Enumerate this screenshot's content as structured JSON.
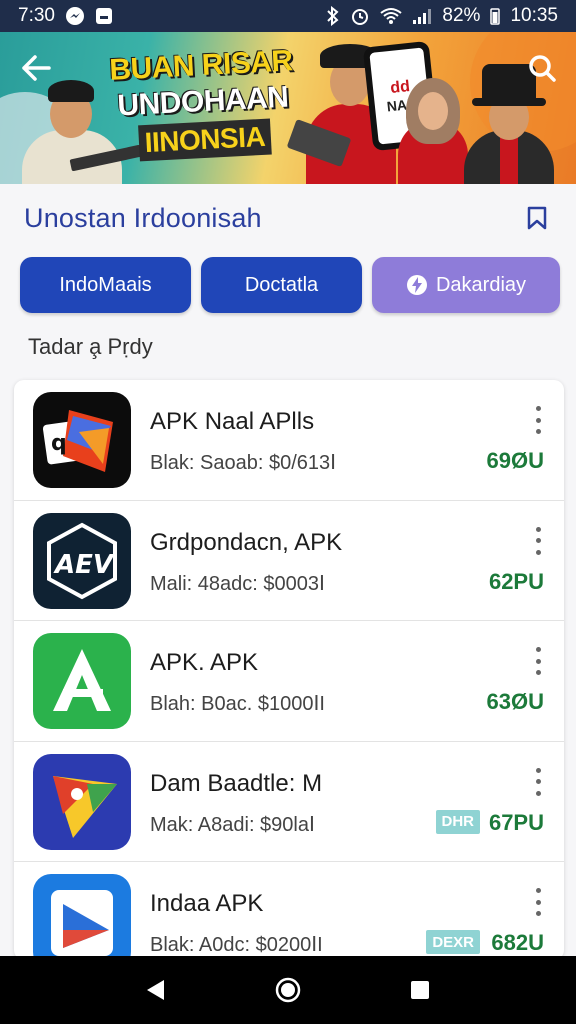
{
  "status_bar": {
    "time": "7:30",
    "battery": "82%",
    "clock": "10:35",
    "icons": [
      "messenger-icon",
      "app-icon",
      "bluetooth-icon",
      "alarm-icon",
      "wifi-icon",
      "signal-icon",
      "battery-icon"
    ]
  },
  "banner": {
    "title_line1": "BUAN RISAR",
    "title_line2": "UNDOHAAN",
    "title_line3": "IINONSIA",
    "phone_text_top": "dd",
    "phone_text_bottom": "NAR"
  },
  "section": {
    "title": "Unostan  Irdoonisah"
  },
  "chips": [
    {
      "label": "IndoMaais"
    },
    {
      "label": "Doctatla"
    },
    {
      "label": "Dakardiay"
    }
  ],
  "sub_label": "Tadar a̧ Pṛdy",
  "apps": [
    {
      "name": "APK Naal APlls",
      "meta": "Blak: Saoab: $0/613Ⅰ",
      "price": "69ØU",
      "tag": ""
    },
    {
      "name": "Grdpondacn, APK",
      "meta": "Mali: 48adc: $0003Ⅰ",
      "price": "62PU",
      "tag": ""
    },
    {
      "name": "APK. APK",
      "meta": "Blah: B0ac. $1000ⅠI",
      "price": "63ØU",
      "tag": ""
    },
    {
      "name": "Dam Baadtle: M",
      "meta": "Mak: A8adi: $90laⅠ",
      "price": "67PU",
      "tag": "DHR"
    },
    {
      "name": "Indaa APK",
      "meta": "Blak: A0dc: $0200ⅠI",
      "price": "682U",
      "tag": "DEXR"
    }
  ],
  "colors": {
    "primary": "#2046b8",
    "accent": "#8e7cd9",
    "price_green": "#1c7a3a",
    "status_bar": "#1f2d4a"
  }
}
